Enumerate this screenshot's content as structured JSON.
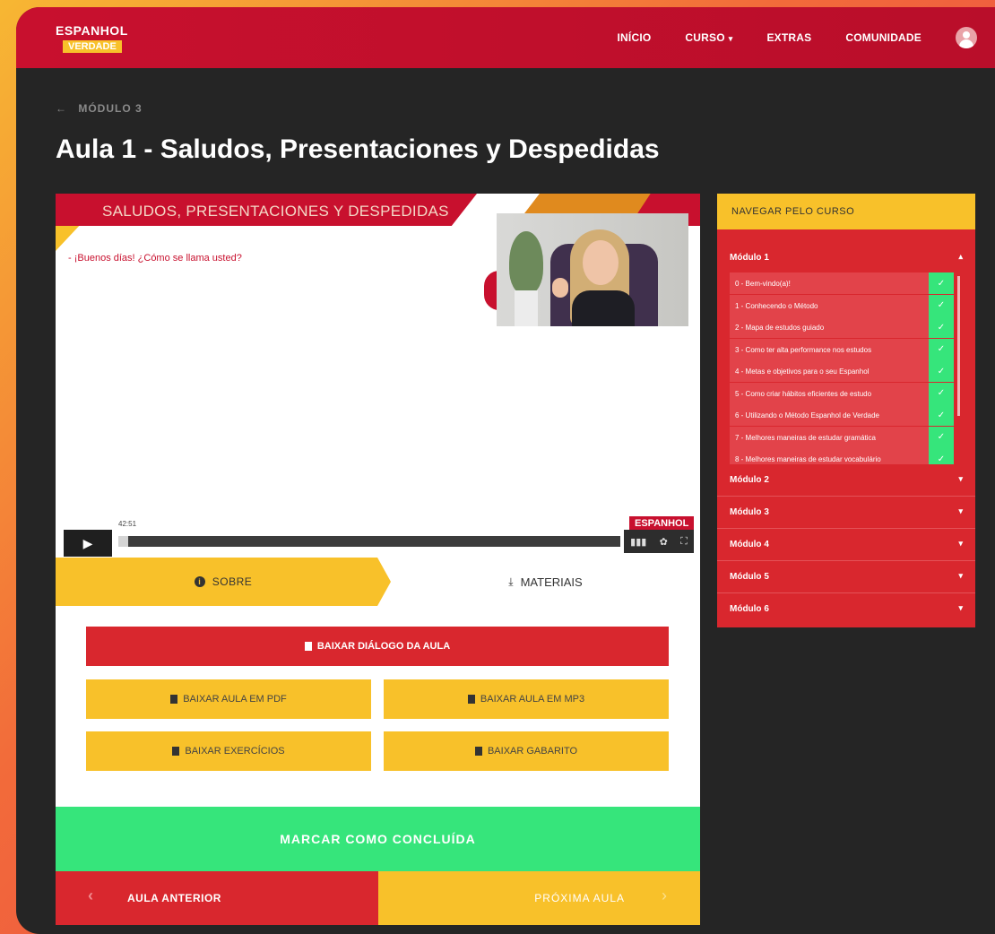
{
  "header": {
    "logo_line1": "ESPANHOL",
    "logo_line2": "VERDADE",
    "nav": [
      {
        "label": "INÍCIO"
      },
      {
        "label": "CURSO",
        "has_dropdown": true
      },
      {
        "label": "EXTRAS"
      },
      {
        "label": "COMUNIDADE"
      }
    ],
    "avatar_icon": "user-avatar-icon"
  },
  "breadcrumb": {
    "label": "MÓDULO 3",
    "icon": "arrow-left-icon"
  },
  "page_title": "Aula 1 - Saludos, Presentaciones y Despedidas",
  "video": {
    "slide_title": "SALUDOS, PRESENTACIONES Y DESPEDIDAS",
    "slide_text": "- ¡Buenos días! ¿Cómo se llama usted?",
    "watermark": "ESPANHOL",
    "time": "42:51",
    "progress": 0.02,
    "play_icon": "play-icon",
    "volume_icon": "volume-icon",
    "settings_icon": "gear-icon",
    "fullscreen_icon": "fullscreen-icon"
  },
  "tabs": {
    "sobre": "SOBRE",
    "materiais": "MATERIAIS"
  },
  "materials": {
    "dialogo": "BAIXAR DIÁLOGO DA AULA",
    "pdf": "BAIXAR AULA EM PDF",
    "mp3": "BAIXAR AULA EM MP3",
    "exercicios": "BAIXAR EXERCÍCIOS",
    "gabarito": "BAIXAR GABARITO"
  },
  "complete_label": "MARCAR COMO CONCLUÍDA",
  "prev_label": "AULA ANTERIOR",
  "next_label": "PRÓXIMA AULA",
  "sidebar": {
    "title": "NAVEGAR PELO CURSO",
    "modules": [
      "Módulo 1",
      "Módulo 2",
      "Módulo 3",
      "Módulo 4",
      "Módulo 5",
      "Módulo 6"
    ],
    "lessons": [
      "0 - Bem-vindo(a)!",
      "1 - Conhecendo o Método",
      "2 - Mapa de estudos guiado",
      "3 - Como ter alta performance nos estudos",
      "4 - Metas e objetivos para o seu Espanhol",
      "5 - Como criar hábitos eficientes de estudo",
      "6 - Utilizando o Método Espanhol de Verdade",
      "7 - Melhores maneiras de estudar gramática",
      "8 - Melhores maneiras de estudar vocabulário"
    ]
  },
  "colors": {
    "brand_red": "#c8102e",
    "brand_yellow": "#f8c12a",
    "success_green": "#36e57b",
    "background": "#252525"
  }
}
